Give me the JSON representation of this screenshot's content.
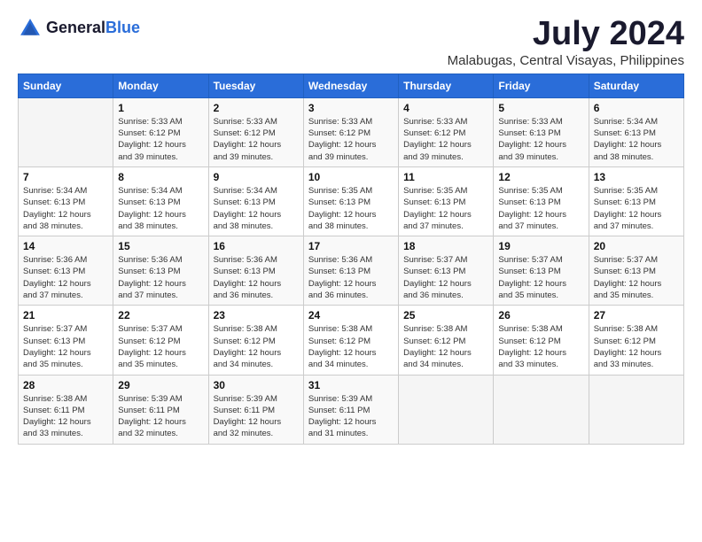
{
  "logo": {
    "general": "General",
    "blue": "Blue"
  },
  "title": "July 2024",
  "location": "Malabugas, Central Visayas, Philippines",
  "days_of_week": [
    "Sunday",
    "Monday",
    "Tuesday",
    "Wednesday",
    "Thursday",
    "Friday",
    "Saturday"
  ],
  "weeks": [
    [
      {
        "day": "",
        "info": ""
      },
      {
        "day": "1",
        "info": "Sunrise: 5:33 AM\nSunset: 6:12 PM\nDaylight: 12 hours\nand 39 minutes."
      },
      {
        "day": "2",
        "info": "Sunrise: 5:33 AM\nSunset: 6:12 PM\nDaylight: 12 hours\nand 39 minutes."
      },
      {
        "day": "3",
        "info": "Sunrise: 5:33 AM\nSunset: 6:12 PM\nDaylight: 12 hours\nand 39 minutes."
      },
      {
        "day": "4",
        "info": "Sunrise: 5:33 AM\nSunset: 6:12 PM\nDaylight: 12 hours\nand 39 minutes."
      },
      {
        "day": "5",
        "info": "Sunrise: 5:33 AM\nSunset: 6:13 PM\nDaylight: 12 hours\nand 39 minutes."
      },
      {
        "day": "6",
        "info": "Sunrise: 5:34 AM\nSunset: 6:13 PM\nDaylight: 12 hours\nand 38 minutes."
      }
    ],
    [
      {
        "day": "7",
        "info": "Sunrise: 5:34 AM\nSunset: 6:13 PM\nDaylight: 12 hours\nand 38 minutes."
      },
      {
        "day": "8",
        "info": "Sunrise: 5:34 AM\nSunset: 6:13 PM\nDaylight: 12 hours\nand 38 minutes."
      },
      {
        "day": "9",
        "info": "Sunrise: 5:34 AM\nSunset: 6:13 PM\nDaylight: 12 hours\nand 38 minutes."
      },
      {
        "day": "10",
        "info": "Sunrise: 5:35 AM\nSunset: 6:13 PM\nDaylight: 12 hours\nand 38 minutes."
      },
      {
        "day": "11",
        "info": "Sunrise: 5:35 AM\nSunset: 6:13 PM\nDaylight: 12 hours\nand 37 minutes."
      },
      {
        "day": "12",
        "info": "Sunrise: 5:35 AM\nSunset: 6:13 PM\nDaylight: 12 hours\nand 37 minutes."
      },
      {
        "day": "13",
        "info": "Sunrise: 5:35 AM\nSunset: 6:13 PM\nDaylight: 12 hours\nand 37 minutes."
      }
    ],
    [
      {
        "day": "14",
        "info": "Sunrise: 5:36 AM\nSunset: 6:13 PM\nDaylight: 12 hours\nand 37 minutes."
      },
      {
        "day": "15",
        "info": "Sunrise: 5:36 AM\nSunset: 6:13 PM\nDaylight: 12 hours\nand 37 minutes."
      },
      {
        "day": "16",
        "info": "Sunrise: 5:36 AM\nSunset: 6:13 PM\nDaylight: 12 hours\nand 36 minutes."
      },
      {
        "day": "17",
        "info": "Sunrise: 5:36 AM\nSunset: 6:13 PM\nDaylight: 12 hours\nand 36 minutes."
      },
      {
        "day": "18",
        "info": "Sunrise: 5:37 AM\nSunset: 6:13 PM\nDaylight: 12 hours\nand 36 minutes."
      },
      {
        "day": "19",
        "info": "Sunrise: 5:37 AM\nSunset: 6:13 PM\nDaylight: 12 hours\nand 35 minutes."
      },
      {
        "day": "20",
        "info": "Sunrise: 5:37 AM\nSunset: 6:13 PM\nDaylight: 12 hours\nand 35 minutes."
      }
    ],
    [
      {
        "day": "21",
        "info": "Sunrise: 5:37 AM\nSunset: 6:13 PM\nDaylight: 12 hours\nand 35 minutes."
      },
      {
        "day": "22",
        "info": "Sunrise: 5:37 AM\nSunset: 6:12 PM\nDaylight: 12 hours\nand 35 minutes."
      },
      {
        "day": "23",
        "info": "Sunrise: 5:38 AM\nSunset: 6:12 PM\nDaylight: 12 hours\nand 34 minutes."
      },
      {
        "day": "24",
        "info": "Sunrise: 5:38 AM\nSunset: 6:12 PM\nDaylight: 12 hours\nand 34 minutes."
      },
      {
        "day": "25",
        "info": "Sunrise: 5:38 AM\nSunset: 6:12 PM\nDaylight: 12 hours\nand 34 minutes."
      },
      {
        "day": "26",
        "info": "Sunrise: 5:38 AM\nSunset: 6:12 PM\nDaylight: 12 hours\nand 33 minutes."
      },
      {
        "day": "27",
        "info": "Sunrise: 5:38 AM\nSunset: 6:12 PM\nDaylight: 12 hours\nand 33 minutes."
      }
    ],
    [
      {
        "day": "28",
        "info": "Sunrise: 5:38 AM\nSunset: 6:11 PM\nDaylight: 12 hours\nand 33 minutes."
      },
      {
        "day": "29",
        "info": "Sunrise: 5:39 AM\nSunset: 6:11 PM\nDaylight: 12 hours\nand 32 minutes."
      },
      {
        "day": "30",
        "info": "Sunrise: 5:39 AM\nSunset: 6:11 PM\nDaylight: 12 hours\nand 32 minutes."
      },
      {
        "day": "31",
        "info": "Sunrise: 5:39 AM\nSunset: 6:11 PM\nDaylight: 12 hours\nand 31 minutes."
      },
      {
        "day": "",
        "info": ""
      },
      {
        "day": "",
        "info": ""
      },
      {
        "day": "",
        "info": ""
      }
    ]
  ]
}
